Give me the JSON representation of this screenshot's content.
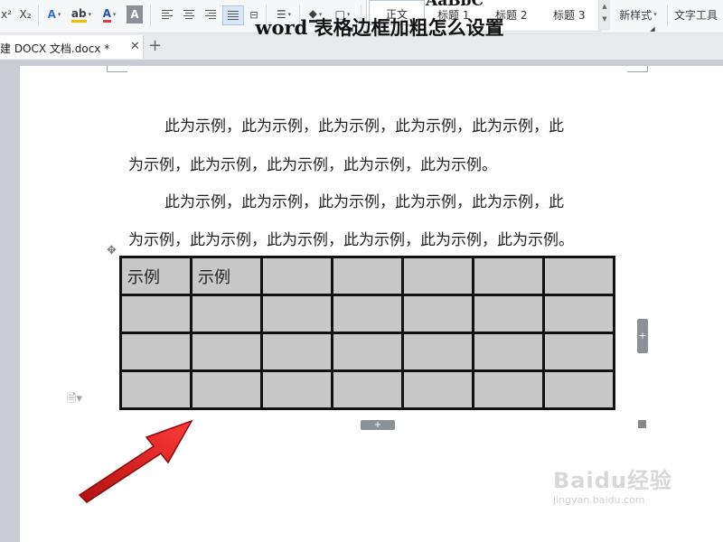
{
  "toolbar": {
    "superscript_label": "x²",
    "subscript_label": "X₂",
    "text_effect_label": "A",
    "highlight_label": "ab",
    "font_color_label": "A",
    "char_shade_label": "A",
    "accent_color": "#e23b3b",
    "icons": [
      "align-left-icon",
      "align-center-icon",
      "align-right-icon",
      "justify-icon",
      "distributed-icon",
      "line-spacing-icon",
      "shading-icon",
      "border-icon"
    ]
  },
  "styles_gallery": {
    "preview_text": "AaBbC",
    "items": [
      "正文",
      "标题 1",
      "标题 2",
      "标题 3"
    ]
  },
  "new_style_label": "新样式",
  "text_tools_label": "文字工具",
  "tabs": [
    {
      "label": "建 DOCX 文档.docx *"
    }
  ],
  "document": {
    "title": "word 表格边框加粗怎么设置",
    "paragraphs": [
      {
        "line1": "此为示例，此为示例，此为示例，此为示例，此为示例，此",
        "line2": "为示例，此为示例，此为示例，此为示例，此为示例。"
      },
      {
        "line1": "此为示例，此为示例，此为示例，此为示例，此为示例，此",
        "line2": "为示例，此为示例，此为示例，此为示例，此为示例，此为示例。"
      }
    ],
    "table": {
      "rows": [
        [
          "示例",
          "示例",
          "",
          "",
          "",
          "",
          ""
        ],
        [
          "",
          "",
          "",
          "",
          "",
          "",
          ""
        ],
        [
          "",
          "",
          "",
          "",
          "",
          "",
          ""
        ],
        [
          "",
          "",
          "",
          "",
          "",
          "",
          ""
        ]
      ]
    }
  },
  "watermark": {
    "text": "Baidu经验",
    "url_text": "jingyan.baidu.com"
  }
}
